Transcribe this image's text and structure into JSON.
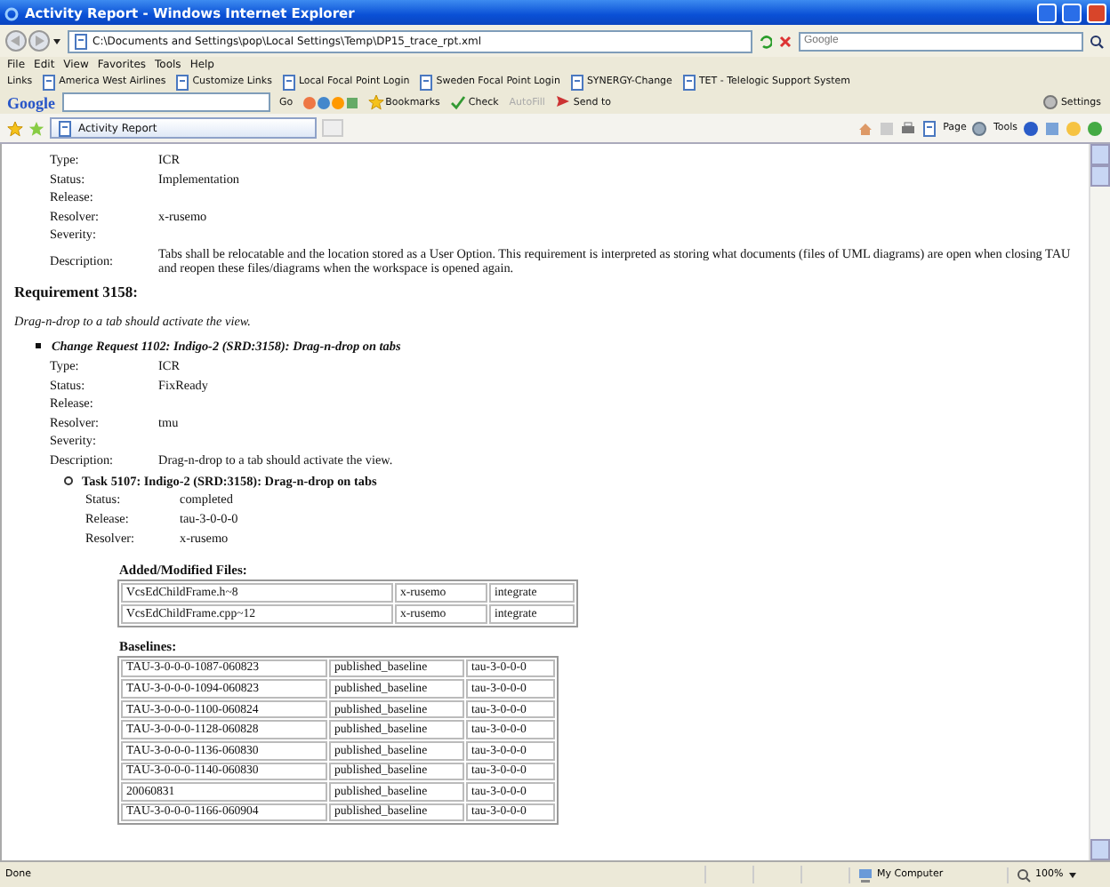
{
  "window": {
    "title": "Activity Report - Windows Internet Explorer"
  },
  "address_bar": {
    "url": "C:\\Documents and Settings\\pop\\Local Settings\\Temp\\DP15_trace_rpt.xml",
    "search_placeholder": "Google"
  },
  "menu": [
    "File",
    "Edit",
    "View",
    "Favorites",
    "Tools",
    "Help"
  ],
  "links": {
    "label": "Links",
    "items": [
      "America West Airlines",
      "Customize Links",
      "Local Focal Point Login",
      "Sweden Focal Point Login",
      "SYNERGY-Change",
      "TET - Telelogic Support System"
    ]
  },
  "google_toolbar": {
    "logo": "Google",
    "go": "Go",
    "bookmarks": "Bookmarks",
    "check": "Check",
    "autofill": "AutoFill",
    "send_to": "Send to",
    "settings": "Settings"
  },
  "tabs": [
    {
      "label": "Activity Report",
      "selected": true
    }
  ],
  "command_bar": [
    "Page",
    "Tools"
  ],
  "report": {
    "first_request": {
      "fields": [
        {
          "label": "Type:",
          "value": "ICR"
        },
        {
          "label": "Status:",
          "value": "Implementation"
        },
        {
          "label": "Release:"
        },
        {
          "label": "Resolver:",
          "value": "x-rusemo"
        },
        {
          "label": "Severity:"
        },
        {
          "label": "Description:",
          "value": "Tabs shall be relocatable and the location stored as a User Option. This requirement is interpreted as storing what documents (files of UML diagrams) are open when closing TAU and reopen these files/diagrams when the workspace is opened again."
        }
      ]
    },
    "requirement": {
      "heading": "Requirement 3158:",
      "summary": "Drag-n-drop to a tab should activate the view.",
      "change_request": {
        "title": "Change Request 1102: Indigo-2 (SRD:3158): Drag-n-drop on tabs",
        "fields": [
          {
            "label": "Type:",
            "value": "ICR"
          },
          {
            "label": "Status:",
            "value": "FixReady"
          },
          {
            "label": "Release:"
          },
          {
            "label": "Resolver:",
            "value": "tmu"
          },
          {
            "label": "Severity:"
          },
          {
            "label": "Description:",
            "value": "Drag-n-drop to a tab should activate the view."
          }
        ],
        "task": {
          "title": "Task 5107: Indigo-2 (SRD:3158): Drag-n-drop on tabs",
          "fields": [
            {
              "label": "Status:",
              "value": "completed"
            },
            {
              "label": "Release:",
              "value": "tau-3-0-0-0"
            },
            {
              "label": "Resolver:",
              "value": "x-rusemo"
            }
          ],
          "files": {
            "heading": "Added/Modified Files:",
            "rows": [
              [
                "VcsEdChildFrame.h~8",
                "x-rusemo",
                "integrate"
              ],
              [
                "VcsEdChildFrame.cpp~12",
                "x-rusemo",
                "integrate"
              ]
            ]
          },
          "baselines": {
            "heading": "Baselines:",
            "rows": [
              [
                "TAU-3-0-0-0-1087-060823",
                "published_baseline",
                "tau-3-0-0-0"
              ],
              [
                "TAU-3-0-0-0-1094-060823",
                "published_baseline",
                "tau-3-0-0-0"
              ],
              [
                "TAU-3-0-0-0-1100-060824",
                "published_baseline",
                "tau-3-0-0-0"
              ],
              [
                "TAU-3-0-0-0-1128-060828",
                "published_baseline",
                "tau-3-0-0-0"
              ],
              [
                "TAU-3-0-0-0-1136-060830",
                "published_baseline",
                "tau-3-0-0-0"
              ],
              [
                "TAU-3-0-0-0-1140-060830",
                "published_baseline",
                "tau-3-0-0-0"
              ],
              [
                "20060831",
                "published_baseline",
                "tau-3-0-0-0"
              ],
              [
                "TAU-3-0-0-0-1166-060904",
                "published_baseline",
                "tau-3-0-0-0"
              ]
            ]
          }
        }
      }
    }
  },
  "status_bar": {
    "text": "Done",
    "zone": "My Computer",
    "zoom": "100%"
  }
}
